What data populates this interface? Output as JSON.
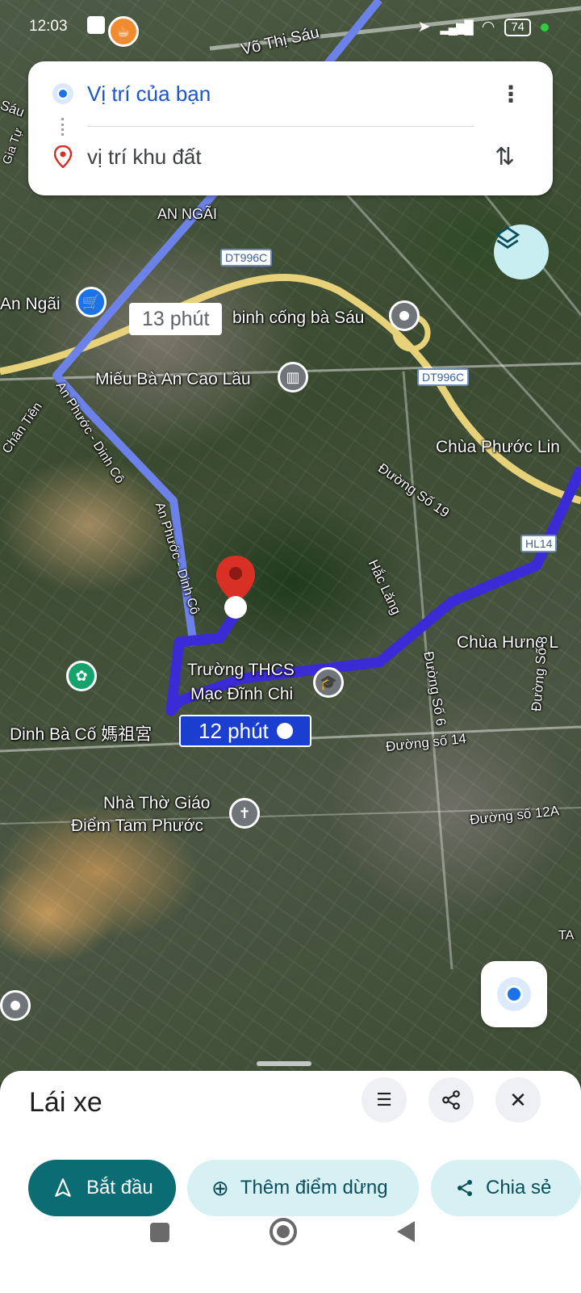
{
  "status_bar": {
    "time": "12:03",
    "battery": "74",
    "notif_icons": [
      "zalo-icon",
      "coffee-icon"
    ]
  },
  "route_card": {
    "origin": "Vị trí của bạn",
    "destination": "vị trí khu đất"
  },
  "map": {
    "route_labels": {
      "main": "12 phút",
      "alt": "13 phút"
    },
    "place_labels": {
      "vo_thi_sau": "Võ Thị Sáu",
      "an_ngai_upper": "AN NGÃI",
      "an_ngai": "An Ngãi",
      "binh_cong": "binh cống bà Sáu",
      "mieu": "Miếu Bà An Cao Lầu",
      "chua_phuoc": "Chùa Phước Lin",
      "duong19": "Đường Số 19",
      "hac_lang": "Hắc Lăng",
      "chua_hung": "Chùa Hưng L",
      "truong_line1": "Trường THCS",
      "truong_line2": "Mạc Đĩnh Chi",
      "dinh_ba": "Dinh Bà Cố 媽祖宮",
      "duong6": "Đường Số 6",
      "duong14": "Đường số 14",
      "duong8": "Đường Số 8",
      "duong12a": "Đường số 12A",
      "nha_tho_line1": "Nhà Thờ Giáo",
      "nha_tho_line2": "Điểm Tam Phước",
      "an_phuoc1": "An Phước - Dinh Cô",
      "an_phuoc2": "An Phước - Dinh Cô",
      "chan_tien": "Chân Tiên",
      "sau": "Sáu",
      "gia_tu": "Gia Tự",
      "ta": "TA"
    },
    "road_tags": {
      "dt1": "DT996C",
      "dt2": "DT996C",
      "hl": "HL14"
    }
  },
  "bottom_sheet": {
    "title": "Lái xe",
    "start": "Bắt đầu",
    "add_stop": "Thêm điểm dừng",
    "share": "Chia sẻ"
  },
  "colors": {
    "route": "#3b2bd6",
    "alt_route": "#6d82e8",
    "primary": "#0b6c73",
    "pill_light": "#d7f0f3",
    "text_blue": "#1a56c9",
    "pin_red": "#d93025"
  }
}
